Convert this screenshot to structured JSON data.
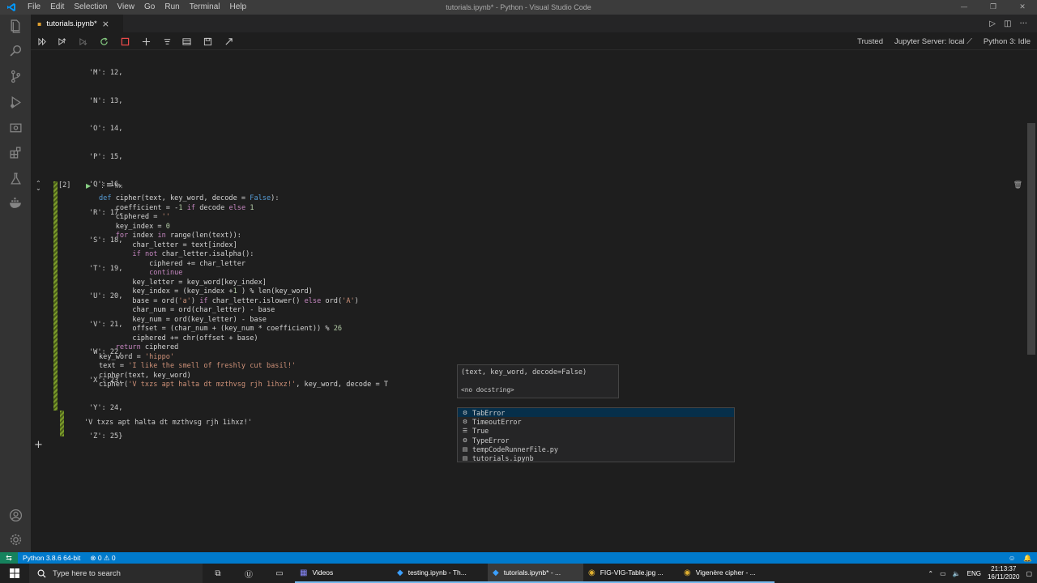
{
  "window": {
    "title": "tutorials.ipynb* - Python - Visual Studio Code",
    "menu": [
      "File",
      "Edit",
      "Selection",
      "View",
      "Go",
      "Run",
      "Terminal",
      "Help"
    ]
  },
  "tab": {
    "label": "tutorials.ipynb*",
    "close": "×"
  },
  "toolbar": {
    "trusted": "Trusted",
    "server": "Jupyter Server: local",
    "kernel": "Python 3: Idle"
  },
  "output1": {
    "lines": [
      "'M': 12,",
      "'N': 13,",
      "'O': 14,",
      "'P': 15,",
      "'Q': 16,",
      "'R': 17,",
      "'S': 18,",
      "'T': 19,",
      "'U': 20,",
      "'V': 21,",
      "'W': 22,",
      "'X': 23,",
      "'Y': 24,",
      "'Z': 25}"
    ]
  },
  "cell": {
    "prompt": "[2]",
    "md_label": "M↓",
    "code": [
      "def cipher(text, key_word, decode = False):",
      "    coefficient = -1 if decode else 1",
      "    ciphered = ''",
      "    key_index = 0",
      "    for index in range(len(text)):",
      "        char_letter = text[index]",
      "        if not char_letter.isalpha():",
      "            ciphered += char_letter",
      "            continue",
      "        key_letter = key_word[key_index]",
      "        key_index = (key_index +1 ) % len(key_word)",
      "",
      "        base = ord('a') if char_letter.islower() else ord('A')",
      "        char_num = ord(char_letter) - base",
      "        key_num = ord(key_letter) - base",
      "        offset = (char_num + (key_num * coefficient)) % 26",
      "        ciphered += chr(offset + base)",
      "    return ciphered",
      "",
      "key_word = 'hippo'",
      "text = 'I like the smell of freshly cut basil!'",
      "cipher(text, key_word)",
      "cipher('V txzs apt halta dt mzthvsg rjh 1ihxz!', key_word, decode = T"
    ],
    "output": "'V txzs apt halta dt mzthvsg rjh 1ihxz!'"
  },
  "hover": {
    "signature": "(text, key_word, decode=False)",
    "doc": "<no docstring>"
  },
  "suggestions": [
    {
      "icon": "class-icon",
      "label": "TabError"
    },
    {
      "icon": "class-icon",
      "label": "TimeoutError"
    },
    {
      "icon": "keyword-icon",
      "label": "True"
    },
    {
      "icon": "class-icon",
      "label": "TypeError"
    },
    {
      "icon": "file-icon",
      "label": "tempCodeRunnerFile.py"
    },
    {
      "icon": "file-icon",
      "label": "tutorials.ipynb"
    }
  ],
  "status": {
    "python": "Python 3.8.6 64-bit",
    "problems": "⊗ 0 ⚠ 0"
  },
  "taskbar": {
    "search_placeholder": "Type here to search",
    "apps": [
      {
        "label": "Videos",
        "icon": "videos-icon",
        "active": false
      },
      {
        "label": "testing.ipynb - Th...",
        "icon": "vscode-icon",
        "active": false
      },
      {
        "label": "tutorials.ipynb* - ...",
        "icon": "vscode-icon",
        "active": true
      },
      {
        "label": "FIG-VIG-Table.jpg ...",
        "icon": "chrome-icon",
        "active": false
      },
      {
        "label": "Vigenère cipher - ...",
        "icon": "chrome-icon",
        "active": false
      }
    ],
    "lang": "ENG",
    "time": "21:13:37",
    "date": "16/11/2020"
  },
  "colors": {
    "accent": "#007acc",
    "activity_bg": "#333333",
    "editor_bg": "#1e1e1e",
    "keyword": "#569cd6",
    "string": "#ce9178",
    "number": "#b5cea8"
  }
}
